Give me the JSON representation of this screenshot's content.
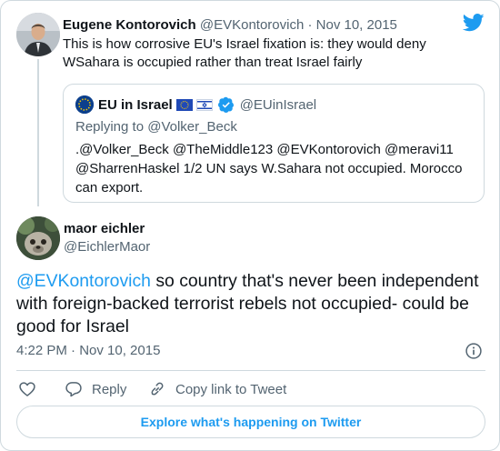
{
  "parent_tweet": {
    "author_name": "Eugene Kontorovich",
    "author_handle": "@EVKontorovich",
    "separator": " · ",
    "date": "Nov 10, 2015",
    "text": "This is how corrosive EU's Israel fixation is: they would deny WSahara is occupied rather than treat Israel fairly"
  },
  "quoted_tweet": {
    "author_name": "EU in Israel",
    "author_handle": "@EUinIsrael",
    "replying_to": "Replying to @Volker_Beck",
    "text": ".@Volker_Beck @TheMiddle123 @EVKontorovich @meravi11 @SharrenHaskel 1/2 UN says W.Sahara not occupied. Morocco can export."
  },
  "main_tweet": {
    "author_name": "maor eichler",
    "author_handle": "@EichlerMaor",
    "mention": "@EVKontorovich",
    "text": " so country that's never been independent with foreign-backed terrorist rebels not occupied- could be good for Israel",
    "timestamp": "4:22 PM · Nov 10, 2015"
  },
  "actions": {
    "reply_label": "Reply",
    "copy_link_label": "Copy link to Tweet"
  },
  "explore_label": "Explore what's happening on Twitter",
  "icons": {
    "brand": "twitter-bird-icon",
    "verified": "verified-badge-icon",
    "info": "info-icon",
    "like": "heart-icon",
    "reply": "speech-bubble-icon",
    "copy": "link-icon"
  },
  "colors": {
    "accent": "#1d9bf0",
    "text": "#0f1419",
    "muted": "#536471",
    "border": "#cfd9de"
  }
}
